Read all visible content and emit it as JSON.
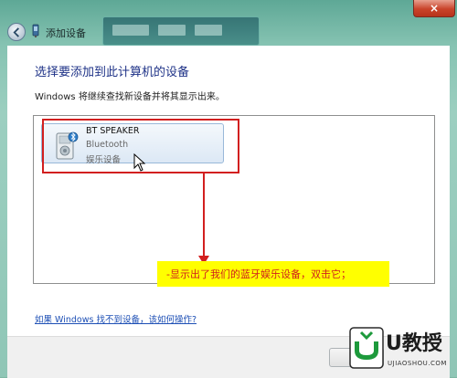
{
  "window": {
    "title": "添加设备",
    "close_label": "×"
  },
  "main": {
    "heading": "选择要添加到此计算机的设备",
    "subtext": "Windows 将继续查找新设备并将其显示出来。",
    "devices": [
      {
        "name": "BT SPEAKER",
        "type": "Bluetooth",
        "category": "娱乐设备"
      }
    ],
    "help_link": "如果 Windows 找不到设备，该如何操作?"
  },
  "annotation": {
    "callout_text": "-显示出了我们的蓝牙娱乐设备，双击它；",
    "color": "#d21f1f",
    "highlight": "#ffff00"
  },
  "footer": {
    "next_label": "下"
  },
  "watermark": {
    "brand": "U教授",
    "url": "UJIAOSHOU.COM"
  }
}
